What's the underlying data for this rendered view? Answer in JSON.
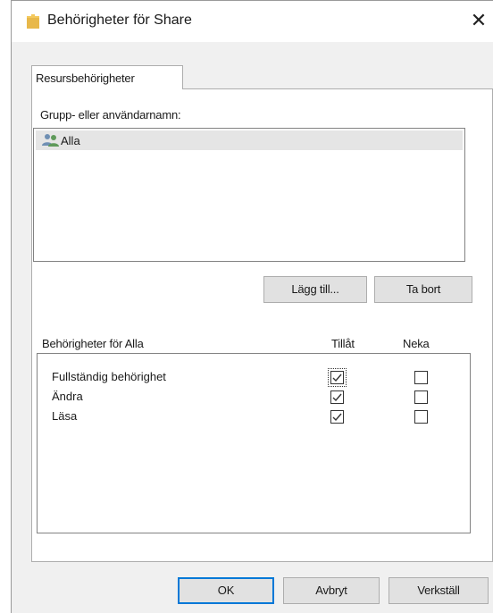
{
  "window": {
    "title": "Behörigheter för Share",
    "close_glyph": "✕"
  },
  "tabs": [
    {
      "label": "Resursbehörigheter",
      "active": true
    }
  ],
  "group_section": {
    "label": "Grupp- eller användarnamn:",
    "items": [
      {
        "name": "Alla",
        "icon": "users-icon",
        "selected": true
      }
    ]
  },
  "group_buttons": {
    "add_label": "Lägg till...",
    "remove_label": "Ta bort"
  },
  "permissions": {
    "header": "Behörigheter för Alla",
    "allow_header": "Tillåt",
    "deny_header": "Neka",
    "rows": [
      {
        "label": "Fullständig behörighet",
        "allow": true,
        "deny": false
      },
      {
        "label": "Ändra",
        "allow": true,
        "deny": false
      },
      {
        "label": "Läsa",
        "allow": true,
        "deny": false
      }
    ]
  },
  "footer": {
    "ok_label": "OK",
    "cancel_label": "Avbryt",
    "apply_label": "Verkställ"
  },
  "colors": {
    "accent": "#0078d7",
    "folder": "#e8b84a",
    "selection": "#e5e5e5"
  }
}
